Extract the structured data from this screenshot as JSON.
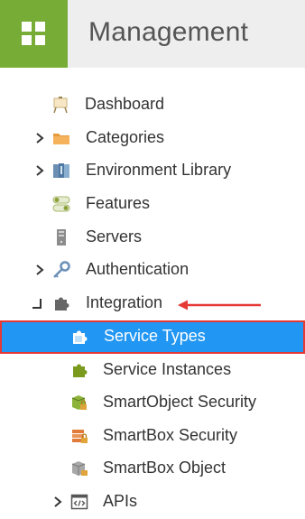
{
  "header": {
    "title": "Management",
    "logo_icon": "tiles-icon",
    "accent_color": "#77ac37"
  },
  "tree": {
    "items": [
      {
        "label": "Dashboard",
        "icon": "easel-icon"
      },
      {
        "label": "Categories",
        "icon": "folder-icon",
        "expander": "collapsed"
      },
      {
        "label": "Environment Library",
        "icon": "server-rack-icon",
        "expander": "collapsed"
      },
      {
        "label": "Features",
        "icon": "toggles-icon"
      },
      {
        "label": "Servers",
        "icon": "server-icon"
      },
      {
        "label": "Authentication",
        "icon": "key-icon",
        "expander": "collapsed"
      },
      {
        "label": "Integration",
        "icon": "puzzle-icon",
        "expander": "expanded"
      },
      {
        "label": "Service Types",
        "icon": "puzzle-blue-icon",
        "selected": true
      },
      {
        "label": "Service Instances",
        "icon": "puzzle-green-icon"
      },
      {
        "label": "SmartObject Security",
        "icon": "smartobject-lock-icon"
      },
      {
        "label": "SmartBox Security",
        "icon": "smartbox-lock-icon"
      },
      {
        "label": "SmartBox Object",
        "icon": "smartbox-object-icon"
      },
      {
        "label": "APIs",
        "icon": "code-window-icon",
        "expander": "collapsed"
      }
    ]
  },
  "annotation": {
    "arrow_color": "#e53935",
    "highlight_color": "#e53935",
    "selection_color": "#2196f3"
  }
}
